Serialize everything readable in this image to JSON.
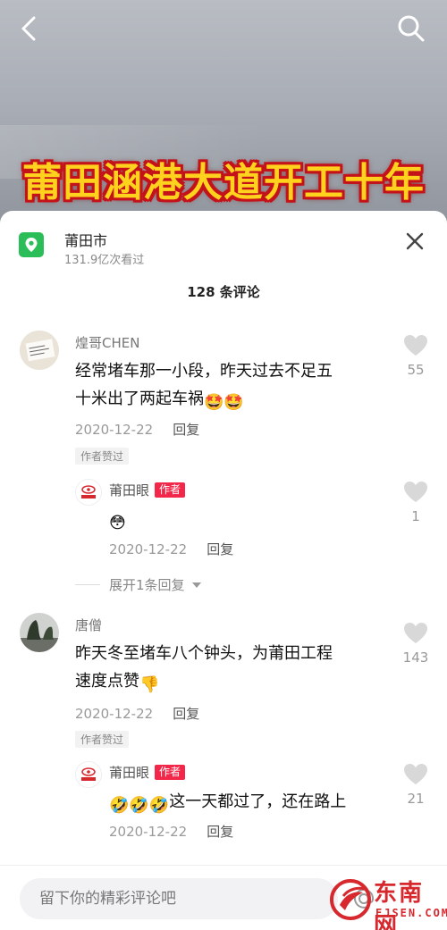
{
  "video": {
    "title": "莆田涵港大道开工十年"
  },
  "location": {
    "name": "莆田市",
    "views": "131.9亿次看过"
  },
  "comments_header": "128 条评论",
  "comments": [
    {
      "user": "煌哥CHEN",
      "text_lines": [
        "经常堵车那一小段，昨天过去不足五",
        "十米出了两起车祸"
      ],
      "emoji_after": "🤩🤩",
      "date": "2020-12-22",
      "reply_label": "回复",
      "liked_tag": "作者赞过",
      "likes": "55",
      "reply": {
        "user": "莆田眼",
        "author_tag": "作者",
        "text": "",
        "emoji": "😳",
        "date": "2020-12-22",
        "reply_label": "回复",
        "likes": "1"
      },
      "expand_label": "展开1条回复"
    },
    {
      "user": "唐僧",
      "text_lines": [
        "昨天冬至堵车八个钟头，为莆田工程",
        "速度点赞"
      ],
      "emoji_after": "👎",
      "date": "2020-12-22",
      "reply_label": "回复",
      "liked_tag": "作者赞过",
      "likes": "143",
      "reply": {
        "user": "莆田眼",
        "author_tag": "作者",
        "emoji": "🤣🤣🤣",
        "text": "这一天都过了，还在路上",
        "date": "2020-12-22",
        "reply_label": "回复",
        "likes": "21"
      }
    }
  ],
  "input": {
    "placeholder": "留下你的精彩评论吧"
  },
  "watermark": {
    "text": "东南网",
    "sub": "FJSEN.COM"
  },
  "colors": {
    "accent": "#f2274a",
    "location_icon": "#2bbd58",
    "title_yellow": "#ffd21e",
    "title_red": "#c4121a"
  }
}
